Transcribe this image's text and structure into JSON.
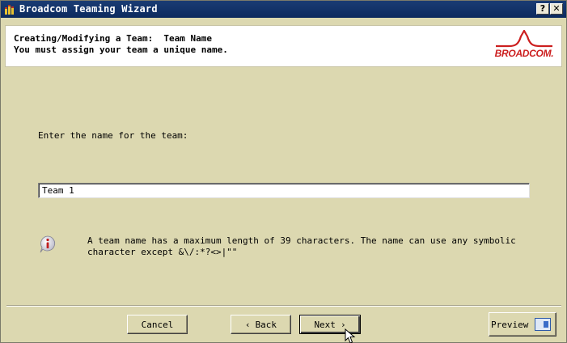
{
  "window": {
    "title": "Broadcom Teaming Wizard",
    "help_label": "?",
    "close_label": "✕"
  },
  "header": {
    "title": "Creating/Modifying a Team:  Team Name",
    "subtitle": "You must assign your team a unique name.",
    "logo_text": "BROADCOM."
  },
  "form": {
    "prompt": "Enter the name for the team:",
    "team_name_value": "Team 1"
  },
  "info": {
    "icon": "info-icon",
    "text": "A team name has a maximum length of 39 characters. The name can use any symbolic character except &\\/:*?<>|\"\""
  },
  "buttons": {
    "cancel": "Cancel",
    "back": "Back",
    "next": "Next",
    "preview": "Preview"
  },
  "colors": {
    "window_bg": "#dcd8b0",
    "titlebar": "#0c2a5e",
    "brand_red": "#cc1f1f"
  }
}
